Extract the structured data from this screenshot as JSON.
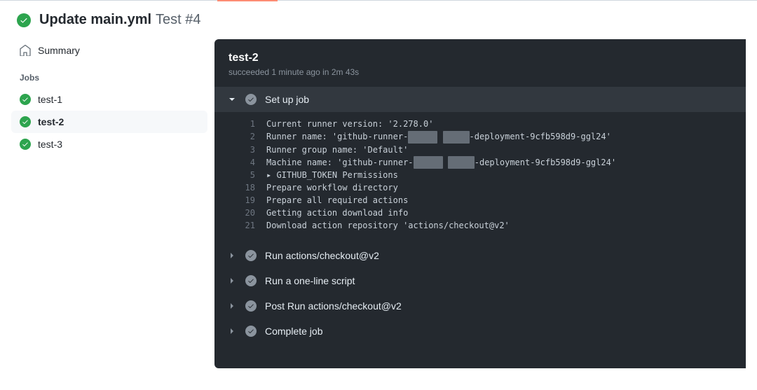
{
  "header": {
    "title": "Update main.yml",
    "subtitle": "Test #4"
  },
  "sidebar": {
    "summary_label": "Summary",
    "jobs_heading": "Jobs",
    "jobs": [
      {
        "label": "test-1",
        "selected": false
      },
      {
        "label": "test-2",
        "selected": true
      },
      {
        "label": "test-3",
        "selected": false
      }
    ]
  },
  "panel": {
    "title": "test-2",
    "meta_status": "succeeded",
    "meta_when": "1 minute ago",
    "meta_in": "in",
    "meta_duration": "2m 43s",
    "steps": [
      {
        "title": "Set up job",
        "expanded": true,
        "lines": [
          {
            "n": "1",
            "text": "Current runner version: '2.278.0'"
          },
          {
            "n": "2",
            "pre": "Runner name: 'github-runner-",
            "redact1_w": 42,
            "mid": " ",
            "redact2_w": 38,
            "post": "-deployment-9cfb598d9-ggl24'"
          },
          {
            "n": "3",
            "text": "Runner group name: 'Default'"
          },
          {
            "n": "4",
            "pre": "Machine name: 'github-runner-",
            "redact1_w": 42,
            "mid": " ",
            "redact2_w": 38,
            "post": "-deployment-9cfb598d9-ggl24'"
          },
          {
            "n": "5",
            "text": "▸ GITHUB_TOKEN Permissions"
          },
          {
            "n": "18",
            "text": "Prepare workflow directory"
          },
          {
            "n": "19",
            "text": "Prepare all required actions"
          },
          {
            "n": "20",
            "text": "Getting action download info"
          },
          {
            "n": "21",
            "text": "Download action repository 'actions/checkout@v2'"
          }
        ]
      },
      {
        "title": "Run actions/checkout@v2",
        "expanded": false
      },
      {
        "title": "Run a one-line script",
        "expanded": false
      },
      {
        "title": "Post Run actions/checkout@v2",
        "expanded": false
      },
      {
        "title": "Complete job",
        "expanded": false
      }
    ]
  }
}
